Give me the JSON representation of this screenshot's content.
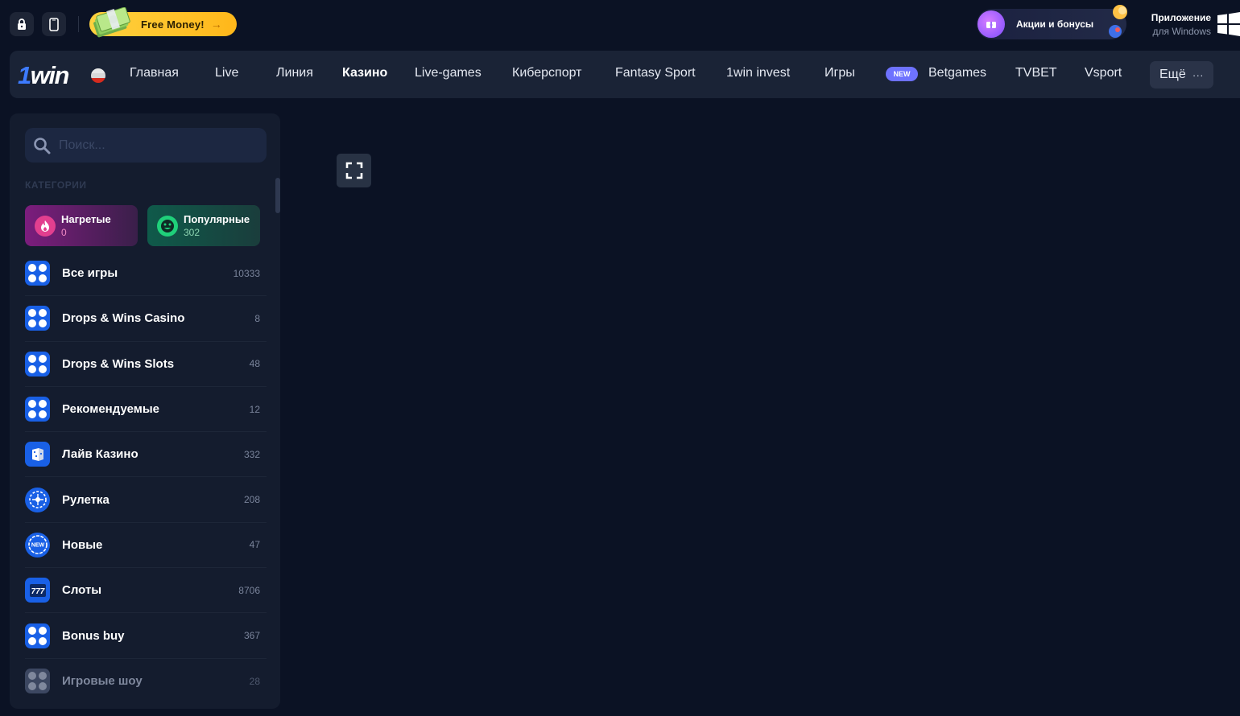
{
  "topbar": {
    "free_money_label": "Free Money!",
    "free_money_arrow": "→",
    "promo_label": "Акции и бонусы",
    "app_title": "Приложение",
    "app_subtitle": "для Windows"
  },
  "nav": {
    "logo_one": "1",
    "logo_win": "win",
    "items": [
      {
        "label": "Главная"
      },
      {
        "label": "Live"
      },
      {
        "label": "Линия"
      },
      {
        "label": "Казино",
        "active": true
      },
      {
        "label": "Live-games"
      },
      {
        "label": "Киберспорт"
      },
      {
        "label": "Fantasy Sport"
      },
      {
        "label": "1win invest"
      },
      {
        "label": "Игры"
      },
      {
        "label": "Betgames",
        "badge": "NEW"
      },
      {
        "label": "TVBET"
      },
      {
        "label": "Vsport"
      }
    ],
    "more_label": "Ещё",
    "more_dots": "···"
  },
  "sidebar": {
    "search_placeholder": "Поиск...",
    "categories_title": "КАТЕГОРИИ",
    "chips": [
      {
        "name": "Нагретые",
        "count": "0"
      },
      {
        "name": "Популярные",
        "count": "302"
      }
    ],
    "categories": [
      {
        "name": "Все игры",
        "count": "10333",
        "icon": "grid-icon"
      },
      {
        "name": "Drops & Wins Casino",
        "count": "8",
        "icon": "grid-icon"
      },
      {
        "name": "Drops & Wins Slots",
        "count": "48",
        "icon": "grid-icon"
      },
      {
        "name": "Рекомендуемые",
        "count": "12",
        "icon": "grid-icon"
      },
      {
        "name": "Лайв Казино",
        "count": "332",
        "icon": "dice-icon"
      },
      {
        "name": "Рулетка",
        "count": "208",
        "icon": "roulette-icon"
      },
      {
        "name": "Новые",
        "count": "47",
        "icon": "new-badge-icon"
      },
      {
        "name": "Слоты",
        "count": "8706",
        "icon": "slot-777-icon"
      },
      {
        "name": "Bonus buy",
        "count": "367",
        "icon": "grid-icon"
      },
      {
        "name": "Игровые шоу",
        "count": "28",
        "icon": "grid-icon"
      }
    ],
    "new_icon_text": "NEW",
    "slot_icon_text": "777"
  }
}
